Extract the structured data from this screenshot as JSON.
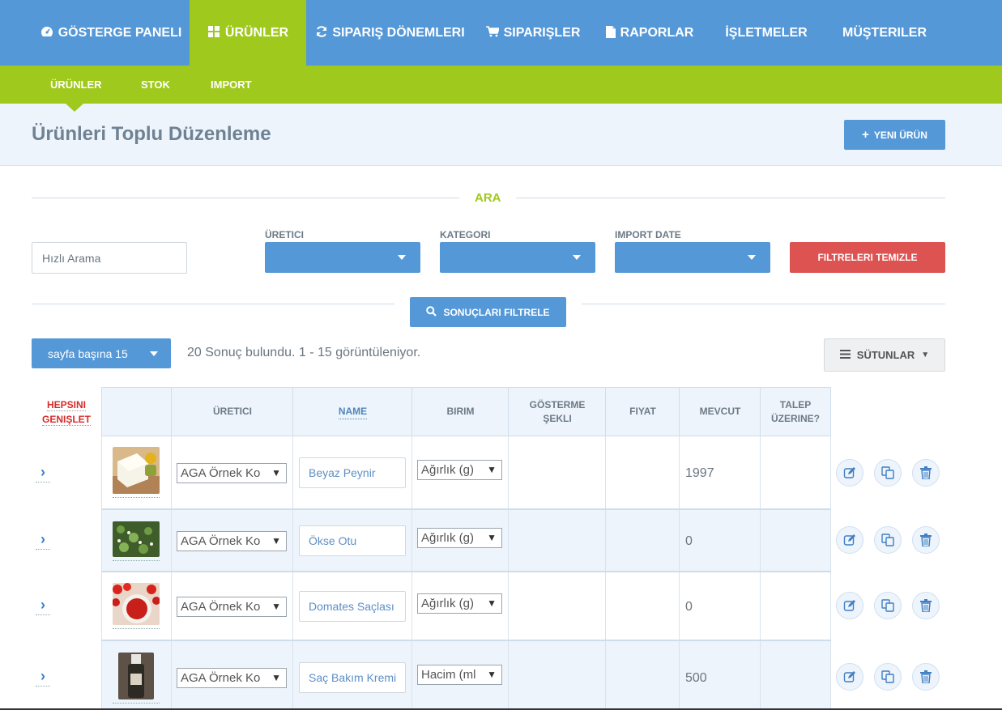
{
  "nav": {
    "items": [
      {
        "label": "GÖSTERGE PANELI",
        "icon": "dashboard-icon"
      },
      {
        "label": "ÜRÜNLER",
        "icon": "grid-icon",
        "active": true
      },
      {
        "label": "SIPARIŞ DÖNEMLERI",
        "icon": "refresh-icon"
      },
      {
        "label": "SIPARIŞLER",
        "icon": "cart-icon"
      },
      {
        "label": "RAPORLAR",
        "icon": "document-icon"
      },
      {
        "label": "İŞLETMELER",
        "icon": ""
      },
      {
        "label": "MÜŞTERILER",
        "icon": ""
      }
    ],
    "active_color": "#a0c91d",
    "bg_color": "#5598d8"
  },
  "subnav": {
    "items": [
      {
        "label": "ÜRÜNLER",
        "active": true
      },
      {
        "label": "STOK"
      },
      {
        "label": "IMPORT"
      }
    ]
  },
  "header": {
    "title": "Ürünleri Toplu Düzenleme",
    "new_button": "YENI ÜRÜN"
  },
  "search": {
    "section_title": "ARA",
    "quick_placeholder": "Hızlı Arama",
    "producer_label": "ÜRETICI",
    "category_label": "KATEGORI",
    "import_date_label": "IMPORT DATE",
    "clear_button": "FILTRELERI TEMIZLE",
    "filter_button": "SONUÇLARI FILTRELE"
  },
  "results": {
    "per_page": "sayfa başına 15",
    "summary": "20 Sonuç bulundu. 1 - 15 görüntüleniyor.",
    "columns_button": "SÜTUNLAR"
  },
  "table": {
    "expand_all": [
      "HEPSINI",
      "GENIŞLET"
    ],
    "headers": {
      "producer": "ÜRETICI",
      "name": "NAME",
      "unit": "BIRIM",
      "display_a": "GÖSTERME",
      "display_b": "ŞEKLI",
      "price": "FIYAT",
      "stock": "MEVCUT",
      "ondemand_a": "TALEP",
      "ondemand_b": "ÜZERINE?"
    },
    "rows": [
      {
        "producer": "AGA Örnek Ko",
        "name": "Beyaz Peynir",
        "unit": "Ağırlık (g)",
        "stock": "1997",
        "thumb": "cheese"
      },
      {
        "producer": "AGA Örnek Ko",
        "name": "Ökse Otu",
        "unit": "Ağırlık (g)",
        "stock": "0",
        "thumb": "herb"
      },
      {
        "producer": "AGA Örnek Ko",
        "name": "Domates Saçlası",
        "unit": "Ağırlık (g)",
        "stock": "0",
        "thumb": "tomato"
      },
      {
        "producer": "AGA Örnek Ko",
        "name": "Saç Bakım Kremi",
        "unit": "Hacim (ml",
        "stock": "500",
        "thumb": "bottle"
      }
    ]
  }
}
